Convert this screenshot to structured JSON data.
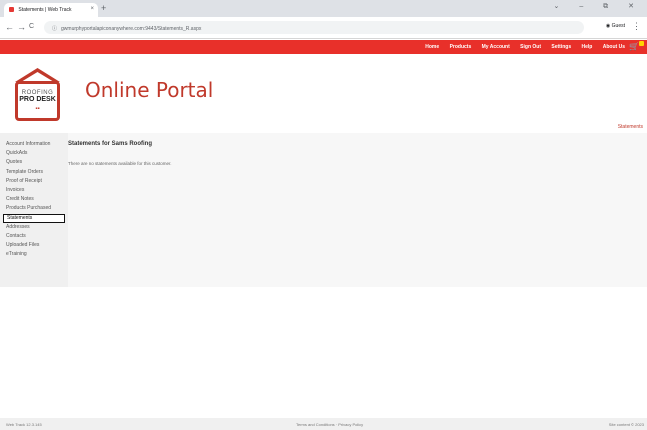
{
  "browser": {
    "tab_title": "Statements | Web Track",
    "tab_close": "×",
    "new_tab": "+",
    "window_controls": "⌄ – ⧉ ✕",
    "back": "←",
    "forward": "→",
    "reload": "C",
    "url": "gwmurphyportalapiconanywhere.com:9443/Statements_R.aspx",
    "profile_label": "Guest",
    "more": "⋮"
  },
  "topnav": {
    "links": [
      "Home",
      "Products",
      "My Account",
      "Sign Out",
      "Settings",
      "Help",
      "About Us"
    ],
    "cart_icon": "cart-icon"
  },
  "header": {
    "logo_line1": "ROOFING",
    "logo_line2": "PRO DESK",
    "logo_dots": "▪▪",
    "title": "Online Portal",
    "right_link": "Statements"
  },
  "sidebar": {
    "items": [
      {
        "label": "Account Information",
        "active": false
      },
      {
        "label": "QuickAds",
        "active": false
      },
      {
        "label": "Quotes",
        "active": false
      },
      {
        "label": "Template Orders",
        "active": false
      },
      {
        "label": "Proof of Receipt",
        "active": false
      },
      {
        "label": "Invoices",
        "active": false
      },
      {
        "label": "Credit Notes",
        "active": false
      },
      {
        "label": "Products Purchased",
        "active": false
      },
      {
        "label": "Statements",
        "active": true
      },
      {
        "label": "Addresses",
        "active": false
      },
      {
        "label": "Contacts",
        "active": false
      },
      {
        "label": "Uploaded Files",
        "active": false
      },
      {
        "label": "eTraining",
        "active": false
      }
    ]
  },
  "main": {
    "heading": "Statements for Sams Roofing",
    "message": "There are no statements available for this customer."
  },
  "footer": {
    "version": "Web Track 12.3.145",
    "links": "Terms and Conditions · Privacy Policy",
    "right": "Site content © 2023"
  },
  "colors": {
    "brand_red": "#e8302a",
    "title_red": "#c0392b",
    "cart_yellow": "#ffd400"
  }
}
